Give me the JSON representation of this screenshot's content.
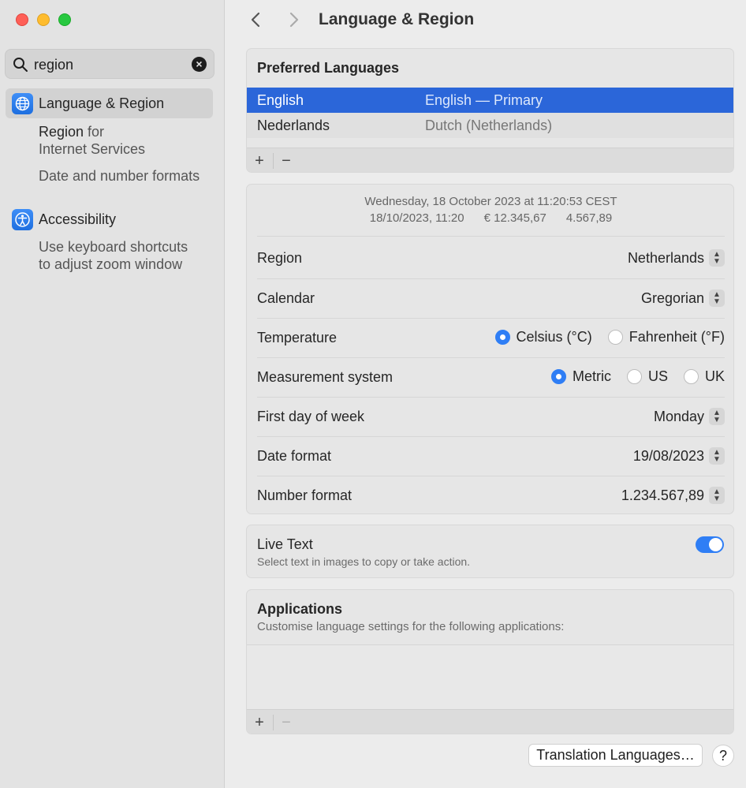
{
  "sidebar": {
    "search": {
      "value": "region",
      "clear_icon": "xmark-circle-icon"
    },
    "results": [
      {
        "label": "Language & Region",
        "icon": "globe-icon",
        "subitems": [
          {
            "line1_strong": "Region",
            "line1_rest": " for",
            "line2": "Internet Services"
          },
          {
            "text": "Date and number formats"
          }
        ]
      },
      {
        "label": "Accessibility",
        "icon": "accessibility-icon",
        "subitems": [
          {
            "line1": "Use keyboard shortcuts",
            "line2": "to adjust zoom window"
          }
        ]
      }
    ]
  },
  "header": {
    "title": "Language & Region",
    "back_icon": "chevron-left-icon",
    "forward_icon": "chevron-right-icon"
  },
  "preferred_languages": {
    "title": "Preferred Languages",
    "rows": [
      {
        "name": "English",
        "detail": "English — Primary"
      },
      {
        "name": "Nederlands",
        "detail": "Dutch (Netherlands)"
      }
    ],
    "add_label": "+",
    "remove_label": "−"
  },
  "formats": {
    "preview_line1": "Wednesday, 18 October 2023 at 11:20:53 CEST",
    "preview_line2": "18/10/2023, 11:20      € 12.345,67      4.567,89",
    "region": {
      "label": "Region",
      "value": "Netherlands"
    },
    "calendar": {
      "label": "Calendar",
      "value": "Gregorian"
    },
    "temperature": {
      "label": "Temperature",
      "options": [
        "Celsius (°C)",
        "Fahrenheit (°F)"
      ],
      "selected": "Celsius (°C)"
    },
    "measurement": {
      "label": "Measurement system",
      "options": [
        "Metric",
        "US",
        "UK"
      ],
      "selected": "Metric"
    },
    "first_day": {
      "label": "First day of week",
      "value": "Monday"
    },
    "date_format": {
      "label": "Date format",
      "value": "19/08/2023"
    },
    "number_format": {
      "label": "Number format",
      "value": "1.234.567,89"
    }
  },
  "live_text": {
    "title": "Live Text",
    "description": "Select text in images to copy or take action.",
    "enabled": true
  },
  "applications": {
    "title": "Applications",
    "description": "Customise language settings for the following applications:",
    "add_label": "+",
    "remove_label": "−"
  },
  "footer": {
    "translation_button": "Translation Languages…",
    "help_label": "?"
  },
  "colors": {
    "accent": "#2f7ef5",
    "selection": "#2b66d9"
  }
}
